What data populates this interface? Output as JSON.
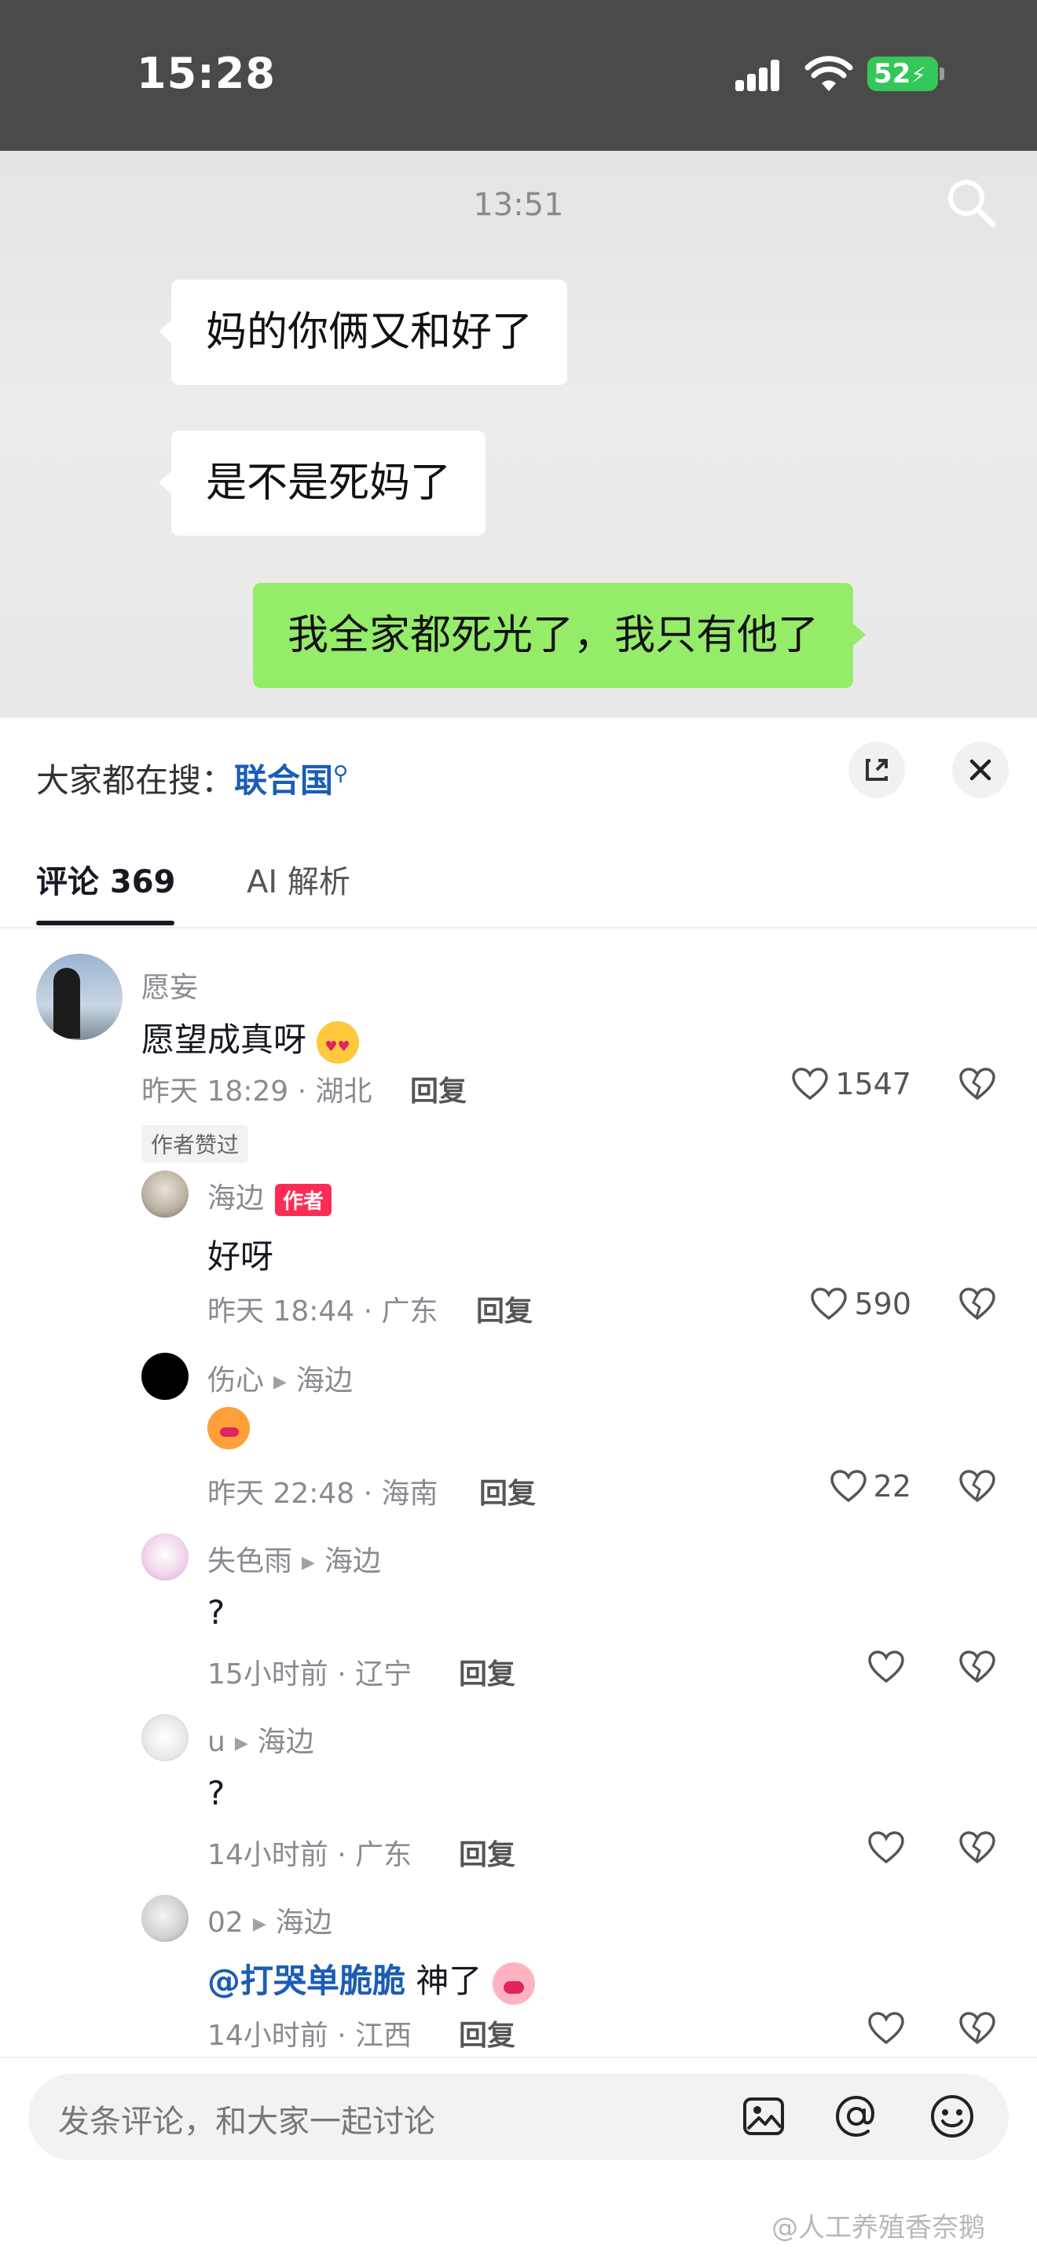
{
  "status_bar": {
    "time": "15:28",
    "battery": "52",
    "icons": [
      "signal-icon",
      "wifi-icon",
      "battery-charging-icon"
    ]
  },
  "video": {
    "timestamp": "13:51",
    "messages": [
      {
        "side": "left",
        "text": "妈的你俩又和好了"
      },
      {
        "side": "left",
        "text": "是不是死妈了"
      },
      {
        "side": "right",
        "text": "我全家都死光了，我只有他了"
      }
    ],
    "icons": [
      "search-icon"
    ]
  },
  "panel": {
    "hot_search_label": "大家都在搜：",
    "hot_search_keyword": "联合国",
    "tabs": [
      {
        "label": "评论 369",
        "active": true
      },
      {
        "label": "AI 解析",
        "active": false
      }
    ],
    "icons": [
      "expand-icon",
      "close-icon"
    ]
  },
  "comments": [
    {
      "user": "愿妄",
      "text": "愿望成真呀",
      "emoji": "love-face-emoji",
      "meta": "昨天 18:29 · 湖北",
      "reply_label": "回复",
      "likes": "1547",
      "badge": "作者赞过"
    },
    {
      "user": "海边",
      "author_tag": "作者",
      "text": "好呀",
      "meta": "昨天 18:44 · 广东",
      "reply_label": "回复",
      "likes": "590"
    },
    {
      "user": "伤心",
      "reply_to": "海边",
      "text": "",
      "emoji": "kiss-face-emoji",
      "meta": "昨天 22:48 · 海南",
      "reply_label": "回复",
      "likes": "22"
    },
    {
      "user": "失色雨",
      "reply_to": "海边",
      "text": "?",
      "meta": "15小时前 · 辽宁",
      "reply_label": "回复",
      "likes": ""
    },
    {
      "user": "u",
      "reply_to": "海边",
      "text": "?",
      "meta": "14小时前 · 广东",
      "reply_label": "回复",
      "likes": ""
    },
    {
      "user": "02",
      "reply_to": "海边",
      "mention": "@打哭单脆脆",
      "text": " 神了",
      "emoji": "pig-face-emoji",
      "meta": "14小时前 · 江西",
      "reply_label": "回复",
      "likes": ""
    }
  ],
  "input_bar": {
    "placeholder": "发条评论，和大家一起讨论",
    "icons": [
      "image-icon",
      "at-icon",
      "emoji-icon"
    ]
  },
  "watermark": "@人工养殖香奈鹅",
  "colors": {
    "accent_red": "#fe2c55",
    "link_blue": "#1a5db4",
    "bubble_green": "#95ec69",
    "battery_green": "#34c759"
  }
}
